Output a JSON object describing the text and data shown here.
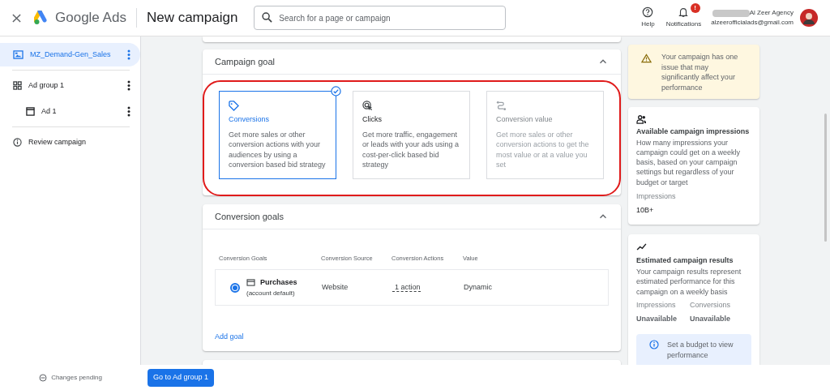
{
  "header": {
    "product": "Google Ads",
    "title": "New campaign",
    "search": {
      "placeholder": "Search for a page or campaign"
    },
    "help": "Help",
    "notifications": {
      "label": "Notifications",
      "badge": "!"
    },
    "account": {
      "name": "Al Zeer Agency",
      "email": "alzeerofficialads@gmail.com"
    }
  },
  "sidebar": {
    "items": [
      {
        "kind": "campaign",
        "label": "MZ_Demand-Gen_Sales",
        "selected": true
      },
      {
        "kind": "adgroup",
        "label": "Ad group 1",
        "selected": false,
        "children": [
          {
            "kind": "ad",
            "label": "Ad 1",
            "selected": false
          }
        ]
      },
      {
        "kind": "review",
        "label": "Review campaign",
        "selected": false
      }
    ],
    "status": "Changes pending"
  },
  "campaign_goal": {
    "title": "Campaign goal",
    "expanded": true,
    "options": [
      {
        "kind": "tag",
        "title": "Conversions",
        "description": "Get more sales or other conversion actions with your audiences by using a conversion based bid strategy",
        "selected": true,
        "disabled": false
      },
      {
        "kind": "click",
        "title": "Clicks",
        "description": "Get more traffic, engagement or leads with your ads using a cost-per-click based bid strategy",
        "selected": false,
        "disabled": false
      },
      {
        "kind": "value",
        "title": "Conversion value",
        "description": "Get more sales or other conversion actions to get the most value or at a value you set",
        "selected": false,
        "disabled": true
      }
    ]
  },
  "conversion_goals": {
    "title": "Conversion goals",
    "expanded": true,
    "columns": [
      "Conversion Goals",
      "Conversion Source",
      "Conversion Actions",
      "Value"
    ],
    "rows": [
      {
        "selected": true,
        "goal": "Purchases",
        "note": "(account default)",
        "source": "Website",
        "actions": "1 action",
        "value": "Dynamic"
      }
    ],
    "add": "Add goal"
  },
  "right_panel": {
    "warning": "Your campaign has one issue that may significantly affect your performance",
    "impressions": {
      "title": "Available campaign impressions",
      "description": "How many impressions your campaign could get on a weekly basis, based on your campaign settings but regardless of your budget or target",
      "label": "Impressions",
      "value": "10B+"
    },
    "results": {
      "title": "Estimated campaign results",
      "description": "Your campaign results represent estimated performance for this campaign on a weekly basis",
      "metrics": [
        {
          "label": "Impressions",
          "value": "Unavailable"
        },
        {
          "label": "Conversions",
          "value": "Unavailable"
        }
      ],
      "info": "Set a budget to view performance"
    }
  },
  "footer": {
    "button": "Go to Ad group 1"
  }
}
